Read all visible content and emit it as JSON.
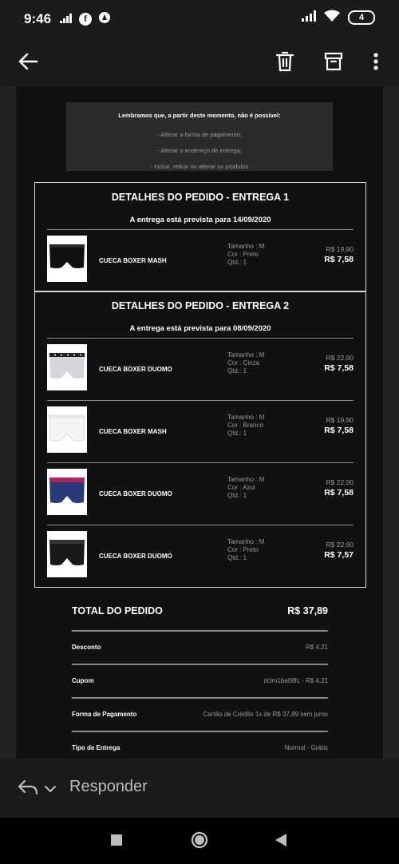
{
  "status_bar": {
    "time": "9:46",
    "battery": "4",
    "icons": [
      "deezer-icon",
      "facebook-icon",
      "notification-app-icon",
      "signal-icon",
      "wifi-icon",
      "battery-icon"
    ]
  },
  "app_bar": {
    "icons": [
      "back-arrow-icon",
      "delete-icon",
      "archive-icon",
      "more-vert-icon"
    ]
  },
  "notice": {
    "title": "Lembramos que, a partir deste momento, não é possível:",
    "lines": [
      "- Alterar a forma de pagamento;",
      "- Alterar o endereço de entrega;",
      "- Incluir, retirar ou alterar os produtos"
    ]
  },
  "deliveries": [
    {
      "title": "DETALHES DO PEDIDO - ENTREGA 1",
      "subtitle": "A entrega está prevista para 14/09/2020",
      "items": [
        {
          "name": "CUECA BOXER MASH",
          "size": "Tamanho : M",
          "color": "Cor : Preto",
          "qty": "Qtd.: 1",
          "old_price": "R$ 19,90",
          "price": "R$ 7,58"
        }
      ]
    },
    {
      "title": "DETALHES DO PEDIDO - ENTREGA 2",
      "subtitle": "A entrega está prevista para 08/09/2020",
      "items": [
        {
          "name": "CUECA BOXER DUOMO",
          "size": "Tamanho : M",
          "color": "Cor : Cinza",
          "qty": "Qtd.: 1",
          "old_price": "R$ 22,90",
          "price": "R$ 7,58"
        },
        {
          "name": "CUECA BOXER MASH",
          "size": "Tamanho : M",
          "color": "Cor : Branco",
          "qty": "Qtd.: 1",
          "old_price": "R$ 19,90",
          "price": "R$ 7,58"
        },
        {
          "name": "CUECA BOXER DUOMO",
          "size": "Tamanho : M",
          "color": "Cor : Azul",
          "qty": "Qtd.: 1",
          "old_price": "R$ 22,90",
          "price": "R$ 7,58"
        },
        {
          "name": "CUECA BOXER DUOMO",
          "size": "Tamanho : M",
          "color": "Cor : Preto",
          "qty": "Qtd.: 1",
          "old_price": "R$ 22,90",
          "price": "R$ 7,57"
        }
      ]
    }
  ],
  "summary": {
    "total_label": "TOTAL DO PEDIDO",
    "total_value": "R$ 37,89",
    "rows": [
      {
        "label": "Desconto",
        "value": "R$ 4,21"
      },
      {
        "label": "Cupom",
        "value": "dclm1ba08fc - R$ 4,21"
      },
      {
        "label": "Forma de Pagamento",
        "value": "Cartão de Crédito 1x de R$ 37,89 sem juros"
      },
      {
        "label": "Tipo de Entrega",
        "value": "Normal - Grátis"
      }
    ]
  },
  "reply": {
    "label": "Responder"
  },
  "colors": {
    "background": "#111111",
    "panel": "#2b2b2b",
    "text": "#ffffff",
    "muted": "#9a9a9a",
    "border": "#d8d8d8"
  }
}
